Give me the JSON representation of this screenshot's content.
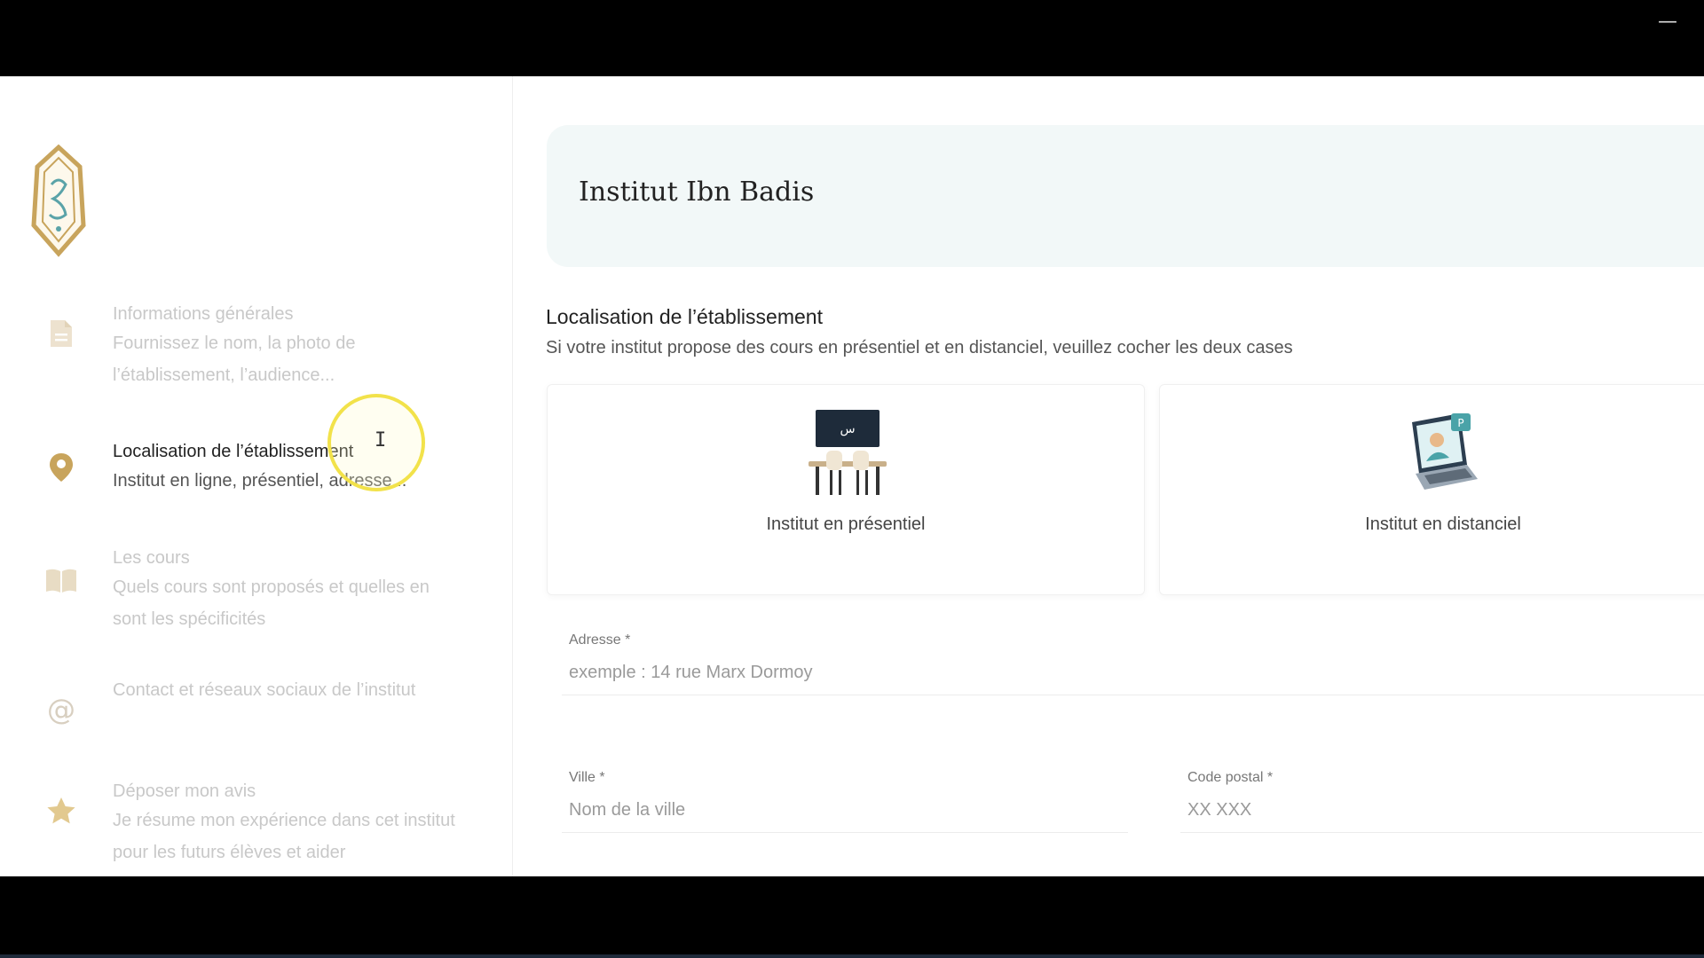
{
  "window": {
    "minimize_glyph": "—"
  },
  "sidebar": {
    "logo_alt": "logo",
    "steps": [
      {
        "icon": "document-icon",
        "title": "Informations générales",
        "desc": "Fournissez le nom, la photo de l’établissement, l’audience..."
      },
      {
        "icon": "location-pin-icon",
        "title": "Localisation de l’établissement",
        "desc": "Institut en ligne, présentiel, adresse..."
      },
      {
        "icon": "open-book-icon",
        "title": "Les cours",
        "desc": "Quels cours sont proposés et quelles en sont les spécificités"
      },
      {
        "icon": "at-sign-icon",
        "title": "Contact et réseaux sociaux de l’institut",
        "desc": "",
        "glyph": "@"
      },
      {
        "icon": "star-icon",
        "title": "Déposer mon avis",
        "desc": "Je résume mon expérience dans cet institut pour les futurs élèves et aider"
      }
    ],
    "active_step": 1
  },
  "main": {
    "institute_name": "Institut Ibn Badis",
    "section_title": "Localisation de l’établissement",
    "section_subtitle": "Si votre institut propose des cours en présentiel et en distanciel, veuillez cocher les deux cases",
    "options": [
      {
        "label": "Institut en présentiel",
        "icon": "classroom-icon",
        "board_text": "س"
      },
      {
        "label": "Institut en distanciel",
        "icon": "online-teacher-laptop-icon"
      }
    ],
    "fields": {
      "adresse": {
        "label": "Adresse",
        "required_mark": "*",
        "placeholder": "exemple : 14 rue Marx Dormoy"
      },
      "ville": {
        "label": "Ville",
        "required_mark": "*",
        "placeholder": "Nom de la ville"
      },
      "code_postal": {
        "label": "Code postal",
        "required_mark": "*",
        "placeholder": "XX XXX"
      }
    }
  },
  "colors": {
    "accent_gold": "#c8a45c",
    "header_bg": "#f2f8f8",
    "cursor_highlight": "#f2e24a"
  }
}
